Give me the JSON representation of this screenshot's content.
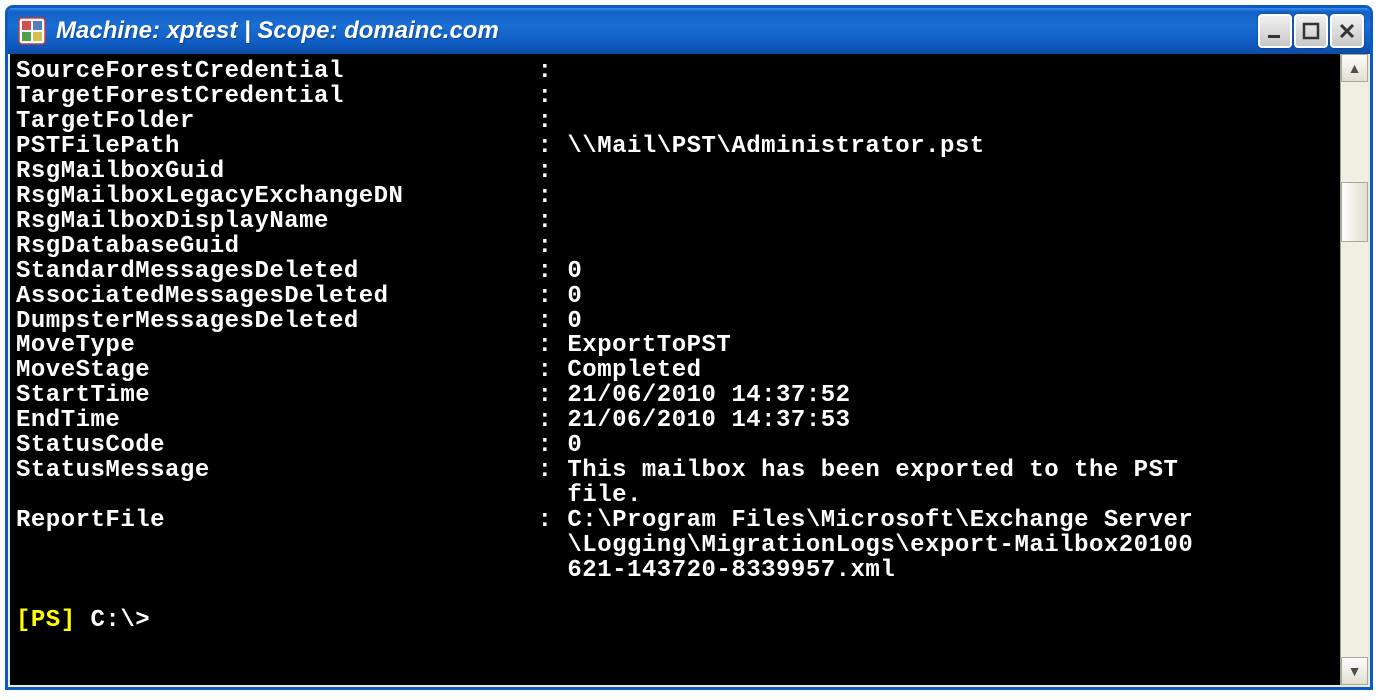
{
  "window": {
    "title": "Machine: xptest | Scope: domainc.com"
  },
  "controls": {
    "min": "_",
    "max": "□",
    "close": "✕"
  },
  "scrollbar": {
    "up": "▲",
    "down": "▼"
  },
  "output": {
    "lines": [
      {
        "key": "SourceForestCredential",
        "value": ""
      },
      {
        "key": "TargetForestCredential",
        "value": ""
      },
      {
        "key": "TargetFolder",
        "value": ""
      },
      {
        "key": "PSTFilePath",
        "value": "\\\\Mail\\PST\\Administrator.pst"
      },
      {
        "key": "RsgMailboxGuid",
        "value": ""
      },
      {
        "key": "RsgMailboxLegacyExchangeDN",
        "value": ""
      },
      {
        "key": "RsgMailboxDisplayName",
        "value": ""
      },
      {
        "key": "RsgDatabaseGuid",
        "value": ""
      },
      {
        "key": "StandardMessagesDeleted",
        "value": "0"
      },
      {
        "key": "AssociatedMessagesDeleted",
        "value": "0"
      },
      {
        "key": "DumpsterMessagesDeleted",
        "value": "0"
      },
      {
        "key": "MoveType",
        "value": "ExportToPST"
      },
      {
        "key": "MoveStage",
        "value": "Completed"
      },
      {
        "key": "StartTime",
        "value": "21/06/2010 14:37:52"
      },
      {
        "key": "EndTime",
        "value": "21/06/2010 14:37:53"
      },
      {
        "key": "StatusCode",
        "value": "0"
      },
      {
        "key": "StatusMessage",
        "value": "This mailbox has been exported to the PST file."
      },
      {
        "key": "ReportFile",
        "value": "C:\\Program Files\\Microsoft\\Exchange Server\\Logging\\MigrationLogs\\export-Mailbox20100621-143720-8339957.xml"
      }
    ],
    "key_col_width": 35,
    "value_col_width": 42
  },
  "prompt": {
    "ps": "[PS]",
    "path": " C:\\>"
  }
}
